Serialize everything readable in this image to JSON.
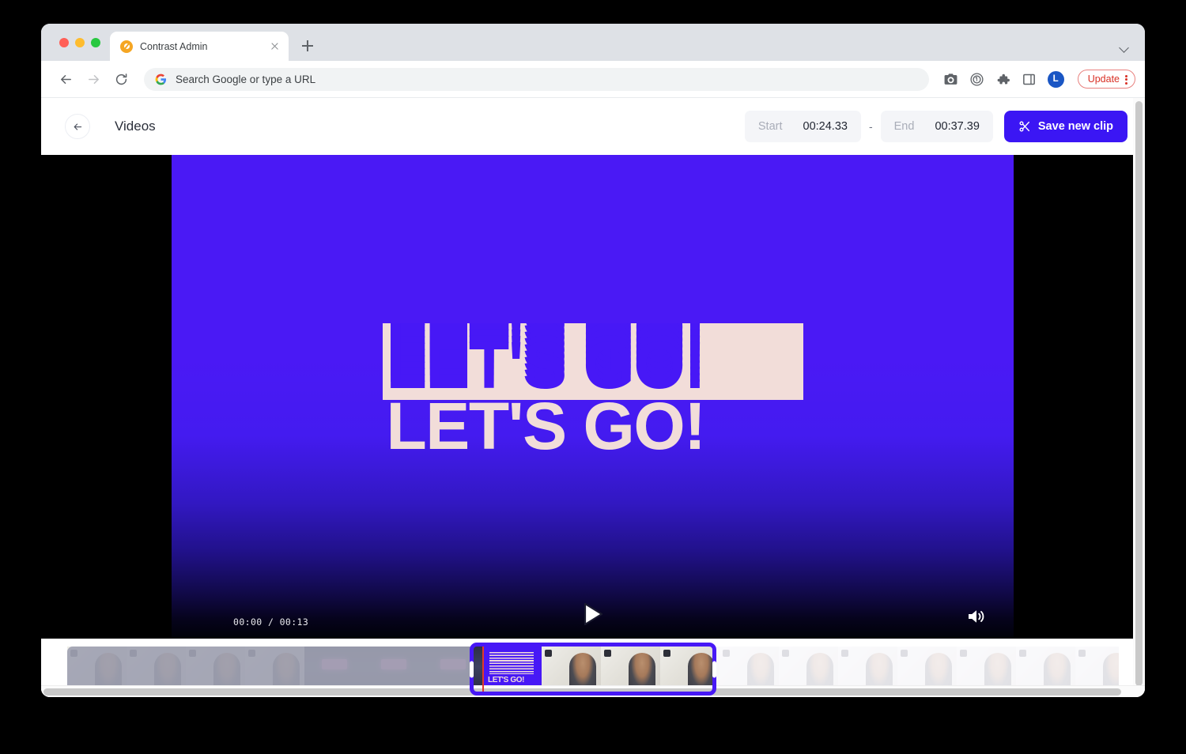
{
  "browser": {
    "tab": {
      "title": "Contrast Admin",
      "favicon": "contrast-logo-icon"
    },
    "omnibox": {
      "placeholder": "Search Google or type a URL",
      "value": ""
    },
    "toolbar": {
      "back_icon": "back-arrow-icon",
      "forward_icon": "forward-arrow-icon",
      "reload_icon": "reload-icon",
      "screenshot_icon": "camera-icon",
      "password_icon": "1password-icon",
      "extensions_icon": "puzzle-piece-icon",
      "sidepanel_icon": "side-panel-icon",
      "avatar_initial": "L",
      "update_label": "Update",
      "kebab_icon": "three-dot-menu-icon"
    },
    "new_tab_label": "+",
    "tab_list_icon": "chevron-down-icon"
  },
  "app": {
    "header": {
      "back_icon": "back-arrow-icon",
      "title": "Videos",
      "start_label": "Start",
      "start_value": "00:24.33",
      "separator": "-",
      "end_label": "End",
      "end_value": "00:37.39",
      "save_icon": "scissors-icon",
      "save_label": "Save new clip"
    },
    "player": {
      "current_time": "00:00",
      "total_time": "00:13",
      "time_display": "00:00 / 00:13",
      "play_icon": "play-triangle-icon",
      "volume_icon": "volume-on-icon",
      "overlay_text": "LET'S GO!",
      "background_top_color": "#4a19f5",
      "background_bottom_color": "#000207",
      "overlay_text_color": "#f2ddd9"
    },
    "timeline": {
      "accent_color": "#4718f6",
      "playhead_color": "#e0392b",
      "left_handle": "trim-handle-left",
      "right_handle": "trim-handle-right",
      "thumbnails_before": [
        {
          "kind": "dimmed"
        },
        {
          "kind": "dimmed"
        },
        {
          "kind": "dimmed"
        },
        {
          "kind": "dimmed"
        },
        {
          "kind": "neon",
          "label": "01:00"
        },
        {
          "kind": "neon",
          "label": "01:00"
        }
      ],
      "thumbnails_selected": [
        {
          "kind": "letsgo",
          "label": "LET'S GO!"
        },
        {
          "kind": "person"
        },
        {
          "kind": "person"
        }
      ],
      "thumbnails_after": [
        {
          "kind": "person"
        },
        {
          "kind": "person"
        },
        {
          "kind": "person"
        },
        {
          "kind": "person"
        },
        {
          "kind": "person"
        },
        {
          "kind": "person"
        },
        {
          "kind": "person"
        }
      ]
    }
  }
}
